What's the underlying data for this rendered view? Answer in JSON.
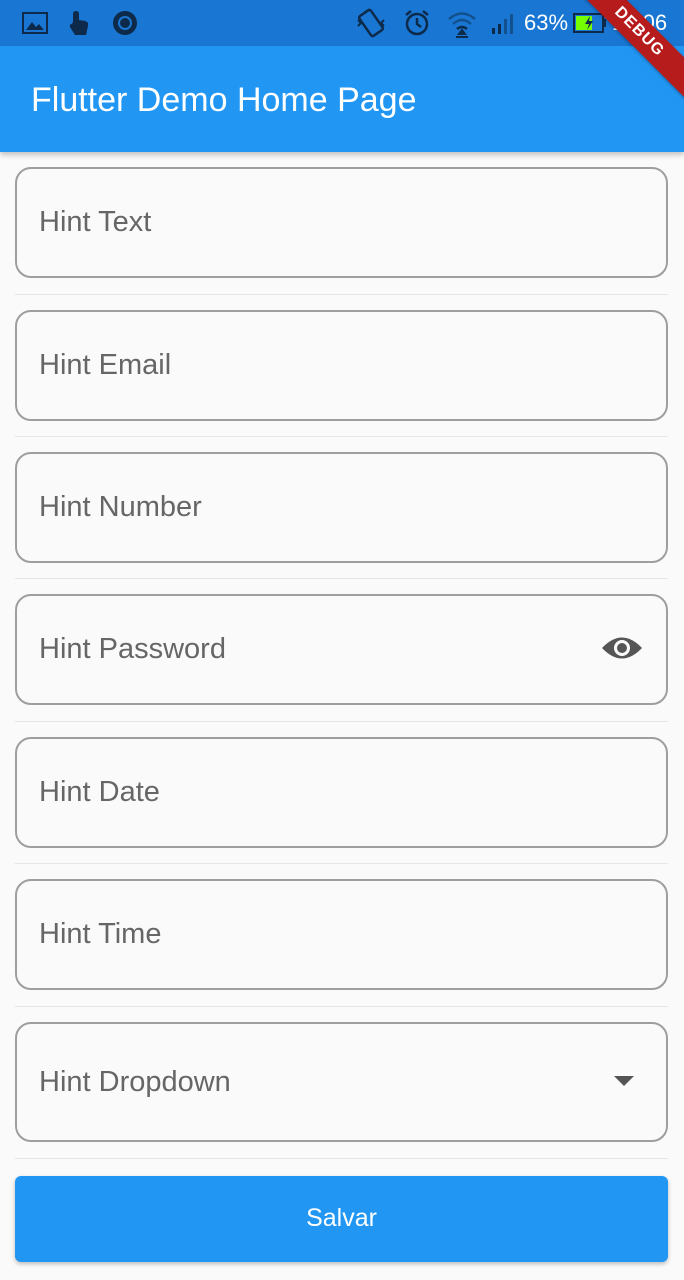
{
  "status_bar": {
    "icons_left": [
      "image-icon",
      "touch-icon",
      "circle-app-icon"
    ],
    "icons_right": [
      "vibrate-icon",
      "alarm-icon",
      "wifi-icon",
      "signal-icon"
    ],
    "battery_percent": "63%",
    "battery_level": 0.63,
    "time": "16:06"
  },
  "app_bar": {
    "title": "Flutter Demo Home Page"
  },
  "debug_banner": "DEBUG",
  "form": {
    "fields": [
      {
        "hint": "Hint Text"
      },
      {
        "hint": "Hint Email"
      },
      {
        "hint": "Hint Number"
      },
      {
        "hint": "Hint Password",
        "suffix_icon": "visibility-eye-icon"
      },
      {
        "hint": "Hint Date"
      },
      {
        "hint": "Hint Time"
      },
      {
        "hint": "Hint Dropdown",
        "suffix_icon": "dropdown-arrow-icon"
      }
    ]
  },
  "submit_button": {
    "label": "Salvar"
  },
  "colors": {
    "status_bar": "#1976d2",
    "app_bar": "#2196f3",
    "button": "#2196f3",
    "field_border": "#9e9e9e",
    "hint_text": "#666666",
    "background": "#fafafa",
    "debug_banner": "#b71c1c"
  }
}
